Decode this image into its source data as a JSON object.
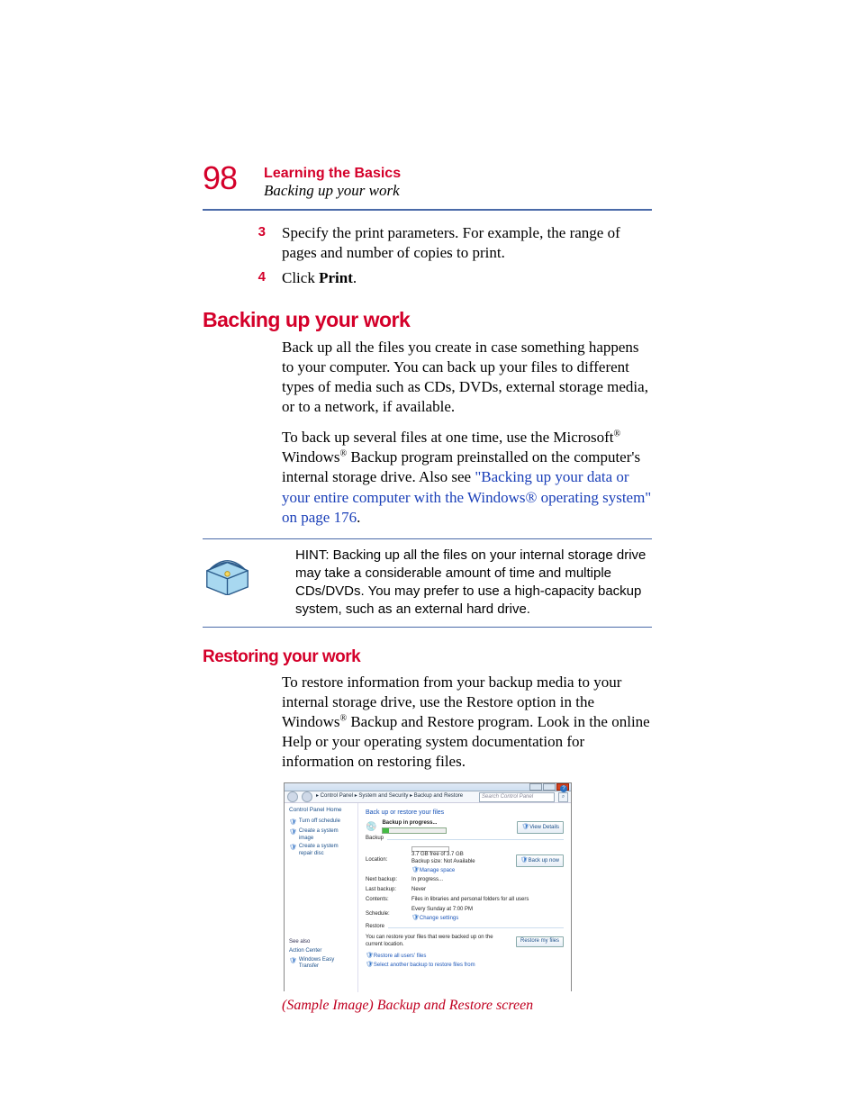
{
  "header": {
    "page_number": "98",
    "chapter": "Learning the Basics",
    "section": "Backing up your work"
  },
  "steps": {
    "s3_num": "3",
    "s3_text": "Specify the print parameters. For example, the range of pages and number of copies to print.",
    "s4_num": "4",
    "s4_prefix": "Click ",
    "s4_bold": "Print",
    "s4_suffix": "."
  },
  "h1": "Backing up your work",
  "para1": "Back up all the files you create in case something happens to your computer. You can back up your files to different types of media such as CDs, DVDs, external storage media, or to a network, if available.",
  "para2_a": "To back up several files at one time, use the Microsoft",
  "para2_b": " Windows",
  "para2_c": " Backup program preinstalled on the computer's internal storage drive. Also see ",
  "para2_link": "\"Backing up your data or your entire computer with the Windows® operating system\" on page 176",
  "para2_d": ".",
  "hint": "HINT: Backing up all the files on your internal storage drive may take a considerable amount of time and multiple CDs/DVDs. You may prefer to use a high-capacity backup system, such as an external hard drive.",
  "h2": "Restoring your work",
  "para3_a": "To restore information from your backup media to your internal storage drive, use the Restore option in the Windows",
  "para3_b": " Backup and Restore program. Look in the online Help or your operating system documentation for information on restoring files.",
  "caption": "(Sample Image) Backup and Restore screen",
  "screenshot": {
    "breadcrumb": "▸ Control Panel ▸ System and Security ▸ Backup and Restore",
    "search_placeholder": "Search Control Panel",
    "side": {
      "home": "Control Panel Home",
      "turn_off": "Turn off schedule",
      "create_image": "Create a system image",
      "create_disc": "Create a system repair disc",
      "see_also": "See also",
      "action_center": "Action Center",
      "easy_transfer": "Windows Easy Transfer"
    },
    "main": {
      "title": "Back up or restore your files",
      "backup_in_progress": "Backup in progress...",
      "view_details": "View Details",
      "backup_legend": "Backup",
      "location_label": "Location:",
      "free_space": "3.7 GB free of 3.7 GB",
      "size_na": "Backup size: Not Available",
      "manage_space": "Manage space",
      "backup_now": "Back up now",
      "next_label": "Next backup:",
      "next_val": "In progress...",
      "last_label": "Last backup:",
      "last_val": "Never",
      "contents_label": "Contents:",
      "contents_val": "Files in libraries and personal folders for all users",
      "schedule_label": "Schedule:",
      "schedule_val": "Every Sunday at 7:00 PM",
      "change_settings": "Change settings",
      "restore_legend": "Restore",
      "restore_text": "You can restore your files that were backed up on the current location.",
      "restore_btn": "Restore my files",
      "restore_all": "Restore all users' files",
      "select_another": "Select another backup to restore files from"
    }
  }
}
